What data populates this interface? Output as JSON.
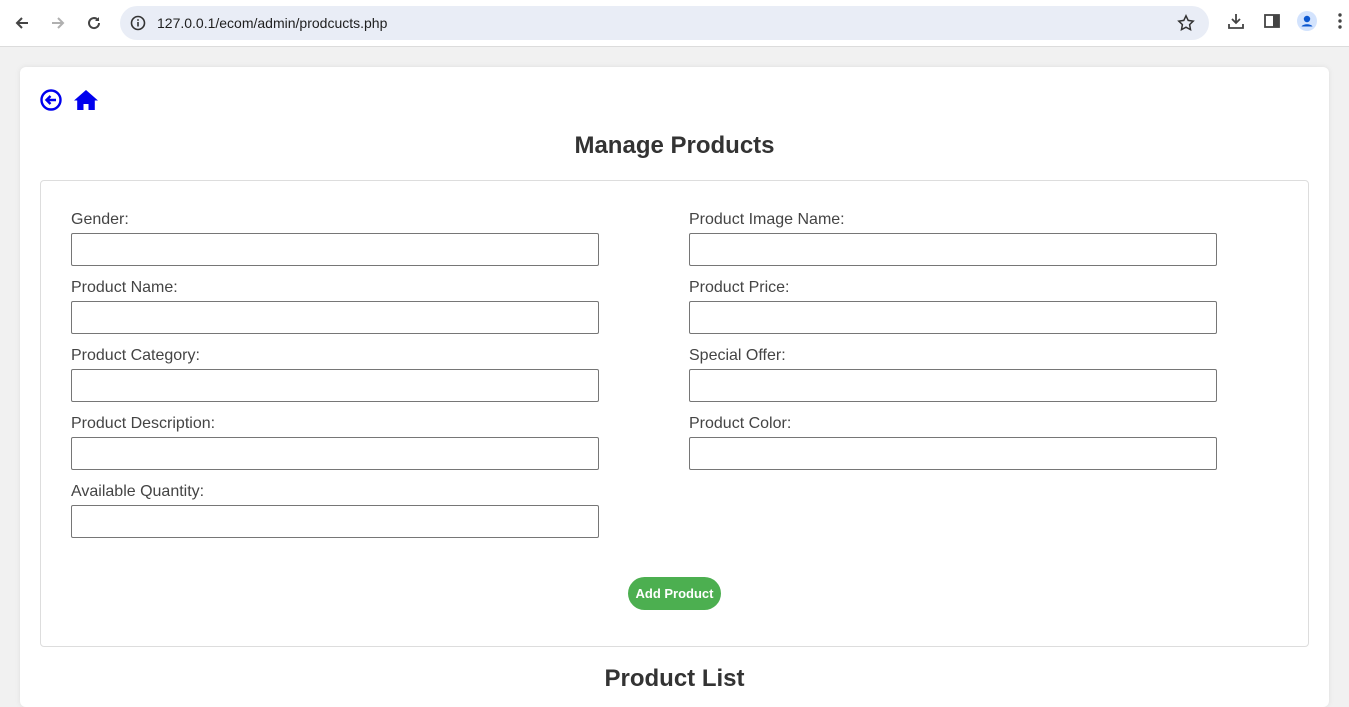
{
  "browser": {
    "url": "127.0.0.1/ecom/admin/prodcucts.php"
  },
  "page": {
    "title": "Manage Products",
    "list_title": "Product List",
    "accent_color": "#4caf50",
    "icon_color": "#0000ee"
  },
  "form": {
    "fields": [
      {
        "label": "Gender:",
        "value": ""
      },
      {
        "label": "Product Name:",
        "value": ""
      },
      {
        "label": "Product Category:",
        "value": ""
      },
      {
        "label": "Product Description:",
        "value": ""
      },
      {
        "label": "Available Quantity:",
        "value": ""
      },
      {
        "label": "Product Image Name:",
        "value": ""
      },
      {
        "label": "Product Price:",
        "value": ""
      },
      {
        "label": "Special Offer:",
        "value": ""
      },
      {
        "label": "Product Color:",
        "value": ""
      }
    ],
    "submit_label": "Add Product"
  }
}
